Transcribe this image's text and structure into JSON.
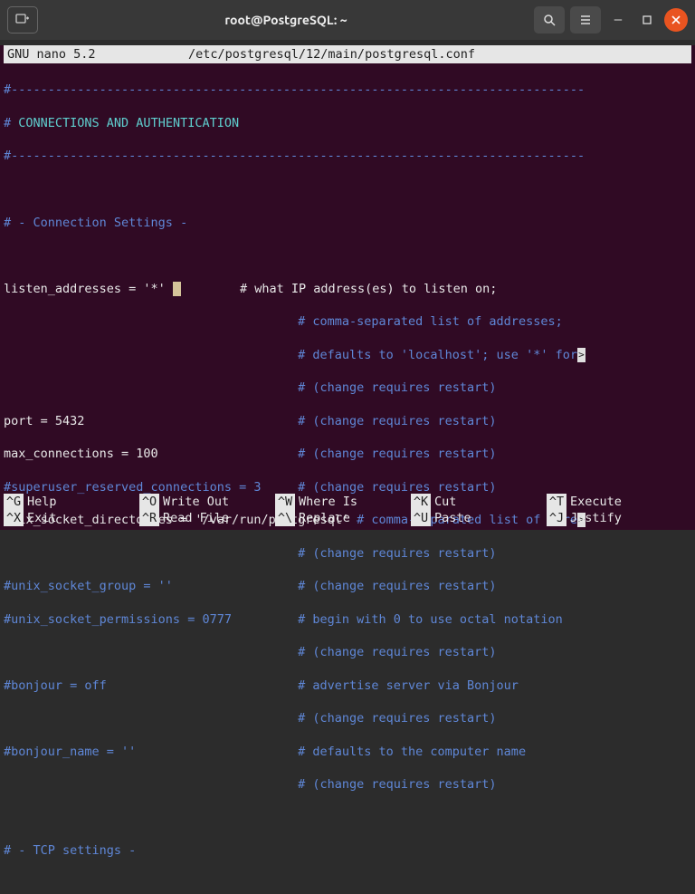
{
  "window": {
    "title": "root@PostgreSQL: ~"
  },
  "nano": {
    "app": "GNU nano 5.2",
    "file": "/etc/postgresql/12/main/postgresql.conf"
  },
  "lines": {
    "l0": "#------------------------------------------------------------------------------",
    "l1a": "# ",
    "l1b": "CONNECTIONS AND AUTHENTICATION",
    "l2": "#------------------------------------------------------------------------------",
    "l3": " ",
    "l4": "# - Connection Settings -",
    "l5": " ",
    "l6a": "listen_addresses = '*' ",
    "l6b": "        # what IP address(es) to listen on;",
    "l7": "                                        # comma-separated list of addresses;",
    "l8a": "                                        # defaults to 'localhost'; use '*' for",
    "l9": "                                        # (change requires restart)",
    "l10a": "port = 5432",
    "l10b": "                             # (change requires restart)",
    "l11a": "max_connections = 100",
    "l11b": "                   # (change requires restart)",
    "l12": "#superuser_reserved_connections = 3     # (change requires restart)",
    "l13a": "unix_socket_directories = '/var/run/postgresql' ",
    "l13b": "# comma-separated list of dire",
    "l14": "                                        # (change requires restart)",
    "l15": "#unix_socket_group = ''                 # (change requires restart)",
    "l16": "#unix_socket_permissions = 0777         # begin with 0 to use octal notation",
    "l17": "                                        # (change requires restart)",
    "l18": "#bonjour = off                          # advertise server via Bonjour",
    "l19": "                                        # (change requires restart)",
    "l20": "#bonjour_name = ''                      # defaults to the computer name",
    "l21": "                                        # (change requires restart)",
    "l22": " ",
    "l23": "# - TCP settings -"
  },
  "shortcuts": [
    [
      {
        "key": "^G",
        "label": "Help"
      },
      {
        "key": "^O",
        "label": "Write Out"
      },
      {
        "key": "^W",
        "label": "Where Is"
      },
      {
        "key": "^K",
        "label": "Cut"
      },
      {
        "key": "^T",
        "label": "Execute"
      }
    ],
    [
      {
        "key": "^X",
        "label": "Exit"
      },
      {
        "key": "^R",
        "label": "Read File"
      },
      {
        "key": "^\\",
        "label": "Replace"
      },
      {
        "key": "^U",
        "label": "Paste"
      },
      {
        "key": "^J",
        "label": "Justify"
      }
    ]
  ]
}
